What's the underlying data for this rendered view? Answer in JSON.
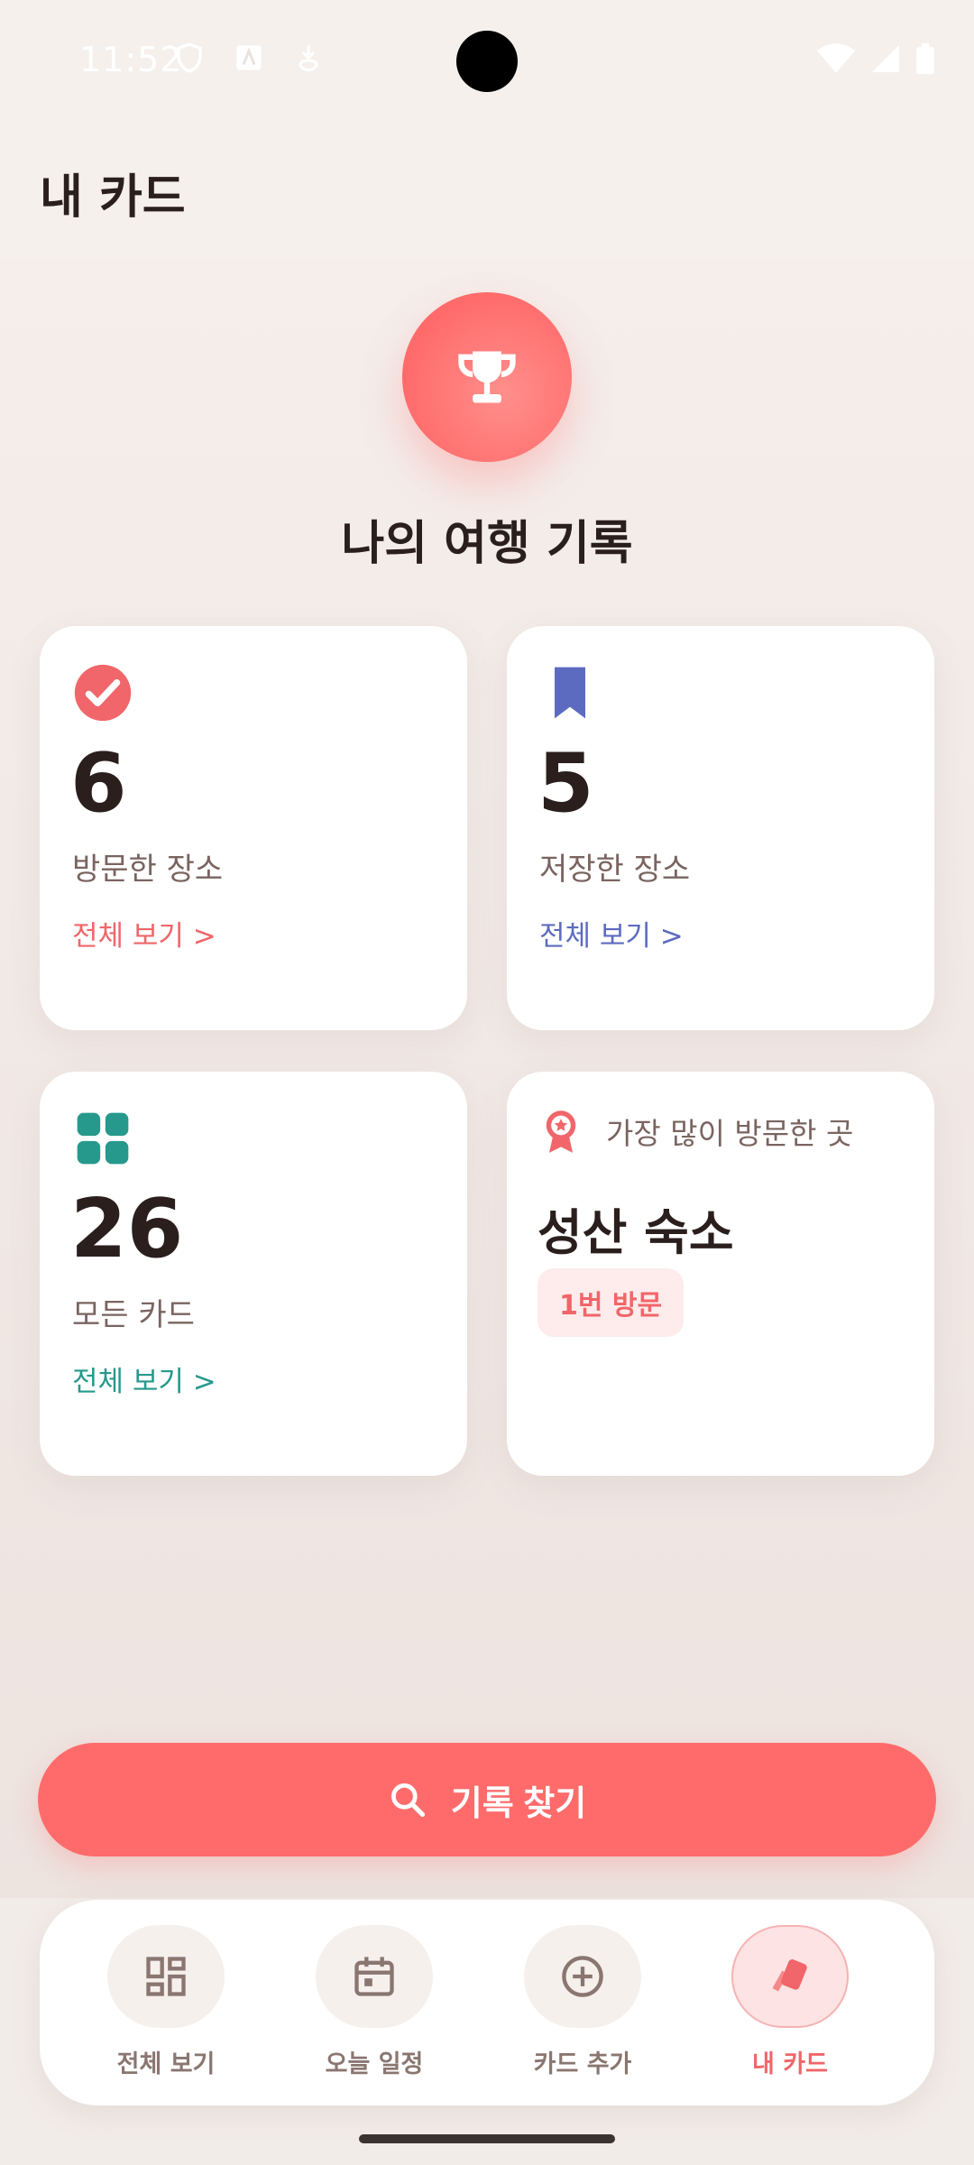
{
  "status_bar": {
    "time": "11:52"
  },
  "header": {
    "title": "내 카드"
  },
  "hero": {
    "title": "나의 여행 기록",
    "icon": "trophy-icon"
  },
  "stats": {
    "visited": {
      "count": "6",
      "label": "방문한 장소",
      "link": "전체 보기 >",
      "color": "#f0666a",
      "icon": "check-circle-icon"
    },
    "saved": {
      "count": "5",
      "label": "저장한 장소",
      "link": "전체 보기 >",
      "color": "#5c6bc0",
      "icon": "bookmark-icon"
    },
    "all_cards": {
      "count": "26",
      "label": "모든 카드",
      "link": "전체 보기 >",
      "color": "#26998c",
      "icon": "grid-icon"
    },
    "most_visited": {
      "label": "가장 많이 방문한 곳",
      "place": "성산 숙소",
      "badge": "1번 방문",
      "icon": "award-icon"
    }
  },
  "search_button": {
    "label": "기록 찾기"
  },
  "bottom_nav": {
    "items": [
      {
        "label": "전체 보기",
        "icon": "dashboard-icon",
        "active": false
      },
      {
        "label": "오늘 일정",
        "icon": "calendar-icon",
        "active": false
      },
      {
        "label": "카드 추가",
        "icon": "add-circle-icon",
        "active": false
      },
      {
        "label": "내 카드",
        "icon": "cards-icon",
        "active": true
      }
    ]
  },
  "colors": {
    "accent": "#ff6b6b",
    "background": "#f5f0ec"
  }
}
